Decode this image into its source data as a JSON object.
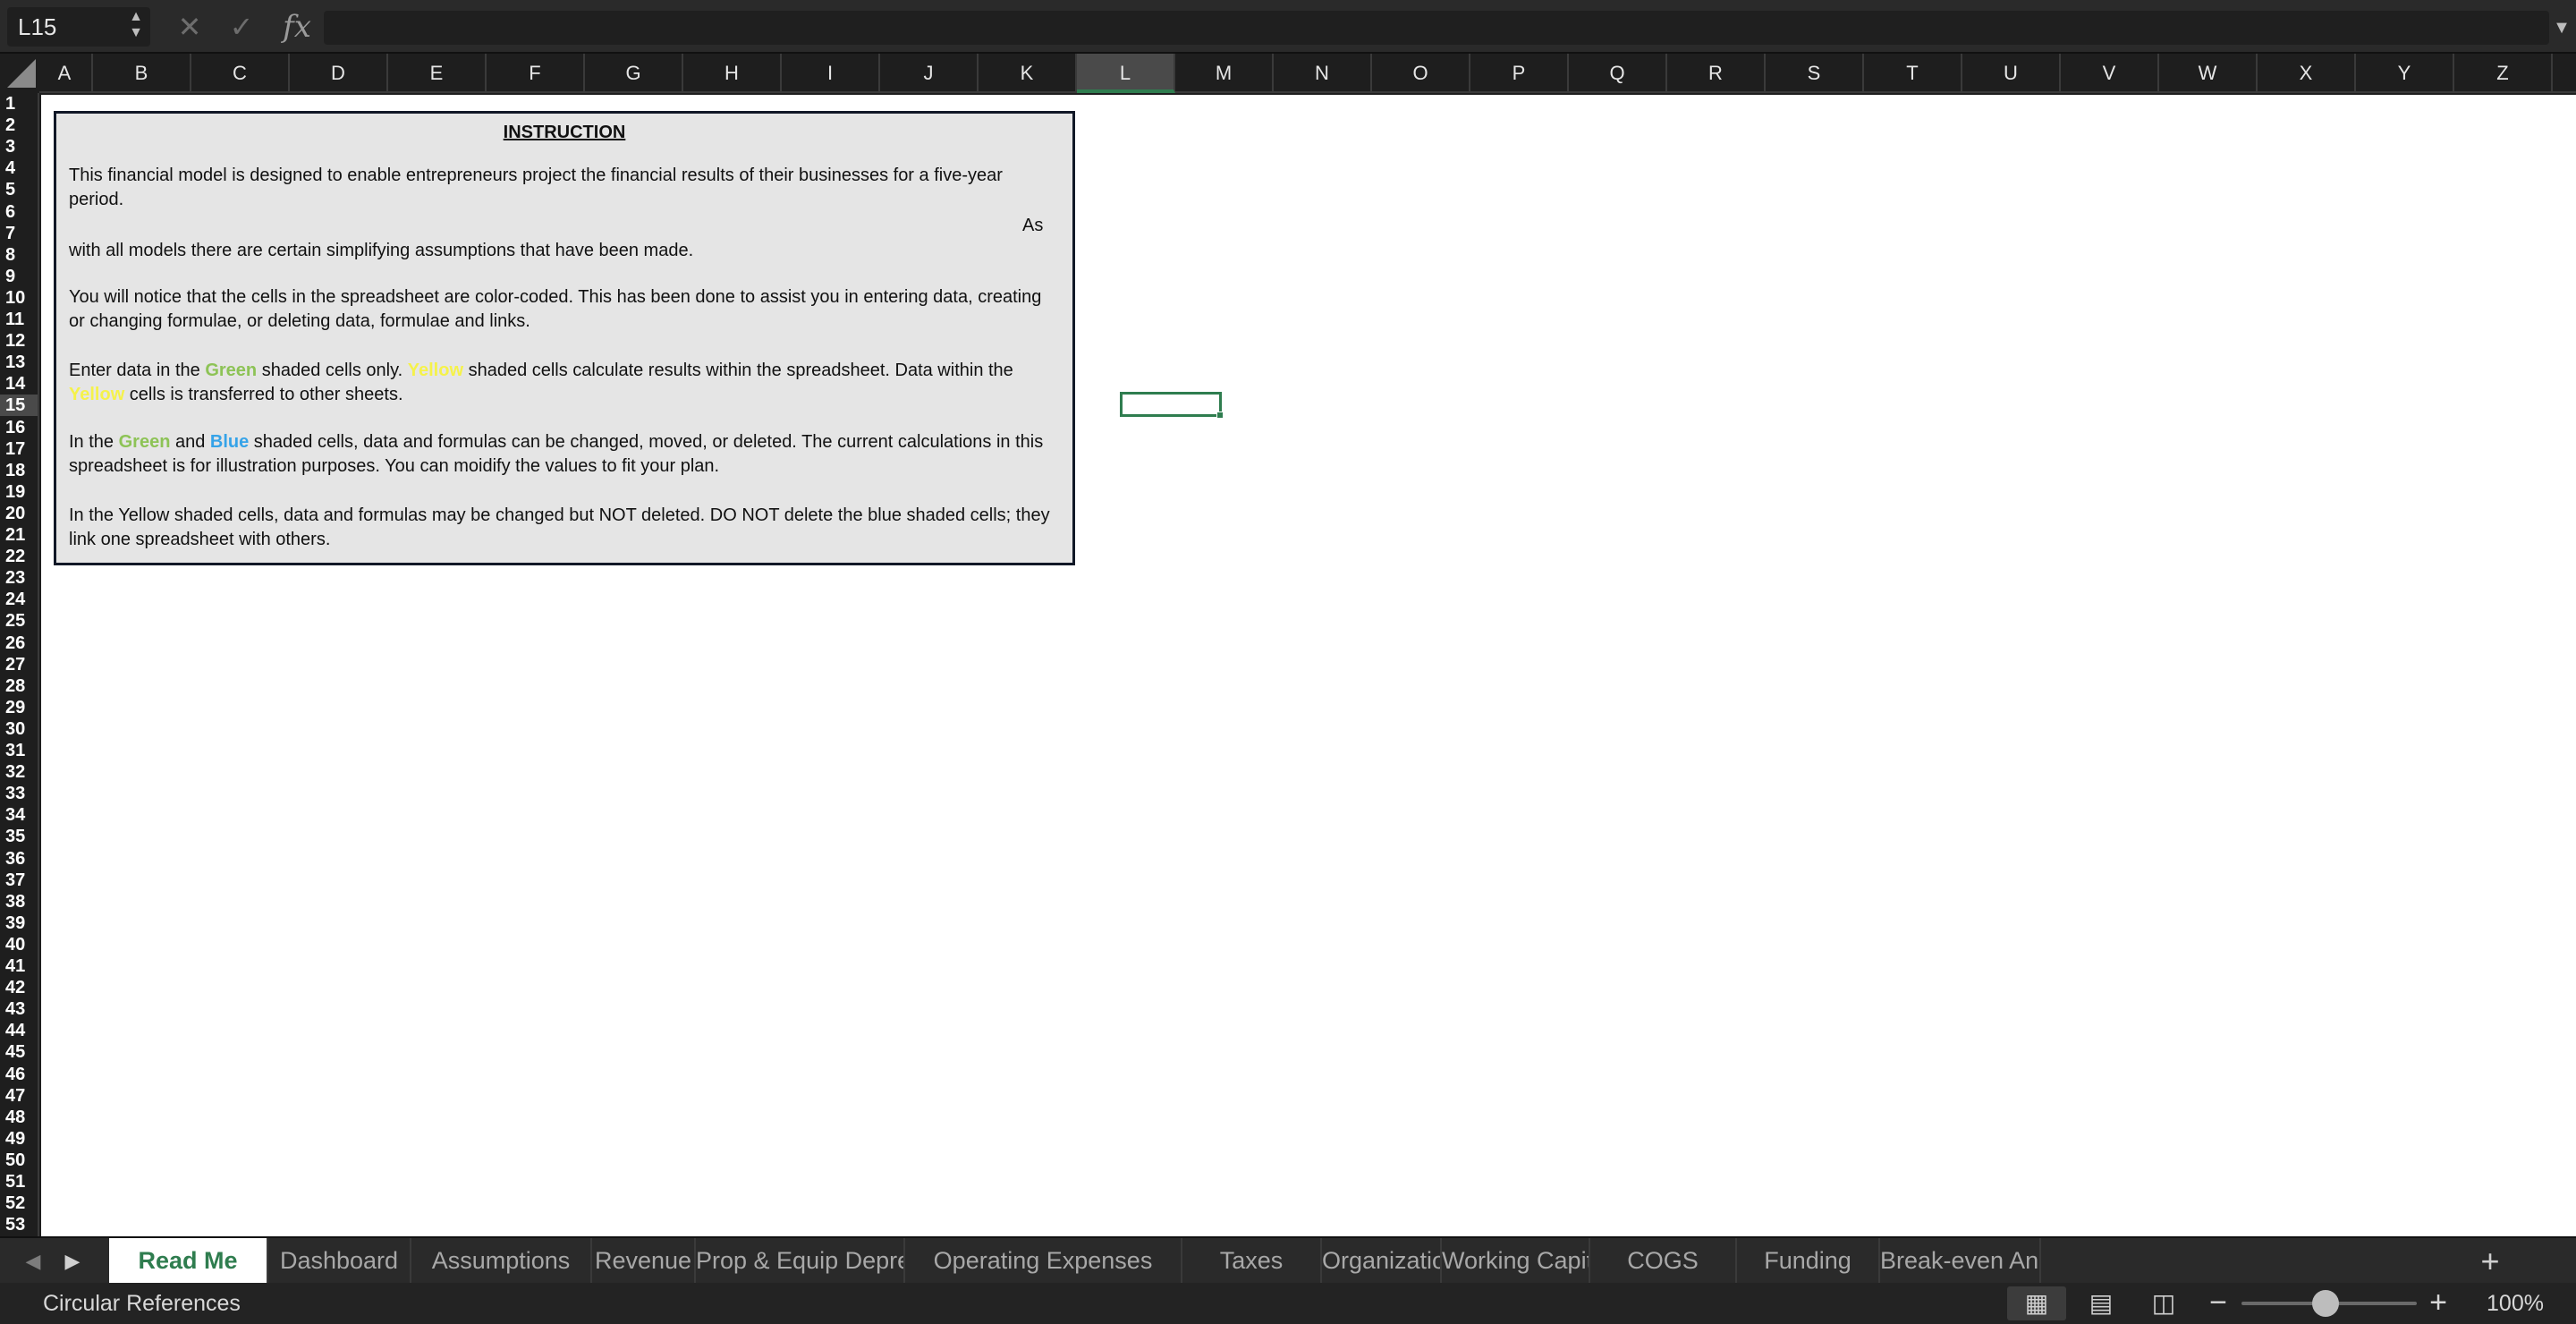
{
  "formula_bar": {
    "name_box": "L15",
    "fx_label": "fx",
    "formula_value": ""
  },
  "grid": {
    "columns": [
      "A",
      "B",
      "C",
      "D",
      "E",
      "F",
      "G",
      "H",
      "I",
      "J",
      "K",
      "L",
      "M",
      "N",
      "O",
      "P",
      "Q",
      "R",
      "S",
      "T",
      "U",
      "V",
      "W",
      "X",
      "Y",
      "Z"
    ],
    "row_count": 53,
    "active_column": "L",
    "active_row": 15
  },
  "instruction": {
    "title": "INSTRUCTION",
    "p1": "This financial model is designed to enable entrepreneurs project the financial results of their businesses for a five-year period.",
    "p1_right": "As",
    "p2": "with all models there are certain simplifying assumptions that have been made.",
    "p3": "You will notice that the cells in the spreadsheet are color-coded. This has been done to assist you in entering data, creating or changing formulae, or deleting data, formulae and links.",
    "p4": {
      "t1": "Enter data in the ",
      "green": "Green",
      "t2": " shaded cells only. ",
      "yellow": "Yellow",
      "t3": " shaded cells calculate results within the spreadsheet. Data within the ",
      "yellow2": "Yellow",
      "t4": " cells is transferred to other sheets."
    },
    "p5": {
      "t1": "In the ",
      "green": "Green",
      "t2": " and ",
      "blue": "Blue",
      "t3": " shaded cells, data and formulas can be changed, moved, or deleted. The current calculations in this spreadsheet is for illustration purposes. You can moidify the values to fit your plan."
    },
    "p6": "In the Yellow shaded cells, data and formulas may be changed but NOT deleted. DO NOT delete the blue shaded cells; they link one spreadsheet with others."
  },
  "tabs": [
    {
      "label": "Read Me",
      "active": true
    },
    {
      "label": "Dashboard",
      "active": false
    },
    {
      "label": "Assumptions",
      "active": false
    },
    {
      "label": "Revenue",
      "active": false
    },
    {
      "label": "Prop & Equip Depreciation",
      "active": false
    },
    {
      "label": "Operating Expenses",
      "active": false
    },
    {
      "label": "Taxes",
      "active": false
    },
    {
      "label": "Organization",
      "active": false
    },
    {
      "label": "Working Capital",
      "active": false
    },
    {
      "label": "COGS",
      "active": false
    },
    {
      "label": "Funding",
      "active": false
    },
    {
      "label": "Break-even Analy",
      "active": false
    }
  ],
  "status_bar": {
    "text": "Circular References",
    "zoom_label": "100%",
    "zoom_fraction": 0.35
  },
  "colors": {
    "accent": "#2f7d4f",
    "green_text": "#8dc356",
    "blue_text": "#35a3e8",
    "yellow_text": "#f5f24a"
  },
  "icons": {
    "cancel": "close-icon",
    "enter": "check-icon",
    "add_sheet": "plus-icon"
  }
}
